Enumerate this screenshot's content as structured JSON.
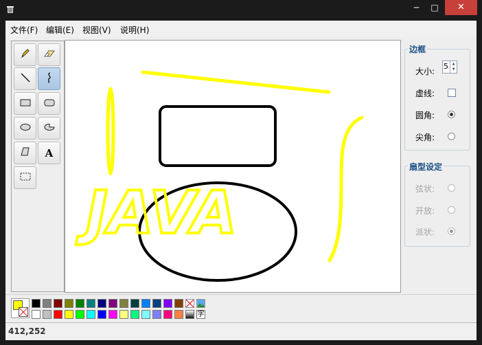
{
  "window": {
    "minimize": "─",
    "maximize": "□",
    "close": "✕"
  },
  "menu": [
    {
      "label": "文件(F)"
    },
    {
      "label": "编辑(E)"
    },
    {
      "label": "视图(V)"
    },
    {
      "label": "说明(H)"
    }
  ],
  "tools": [
    {
      "name": "pencil-icon",
      "selected": false
    },
    {
      "name": "eraser-icon",
      "selected": false
    },
    {
      "name": "line-icon",
      "selected": false
    },
    {
      "name": "curve-icon",
      "selected": true
    },
    {
      "name": "rectangle-icon",
      "selected": false
    },
    {
      "name": "rounded-rectangle-icon",
      "selected": false
    },
    {
      "name": "ellipse-icon",
      "selected": false
    },
    {
      "name": "pie-icon",
      "selected": false
    },
    {
      "name": "polygon-icon",
      "selected": false
    },
    {
      "name": "text-tool-icon",
      "selected": false
    },
    {
      "name": "select-icon",
      "selected": false
    }
  ],
  "text_tool_glyph": "A",
  "canvas": {
    "text": "JAVA",
    "stroke_color": "#000000",
    "fill_color": "#ffff00"
  },
  "border_panel": {
    "title": "边框",
    "size_label": "大小:",
    "size_value": "5",
    "dashed_label": "虚线:",
    "dashed_checked": false,
    "round_label": "圆角:",
    "round_selected": true,
    "sharp_label": "尖角:",
    "sharp_selected": false
  },
  "fan_panel": {
    "title": "扇型设定",
    "chord_label": "弦状:",
    "chord_selected": false,
    "open_label": "开放:",
    "open_selected": false,
    "pie_label": "派状:",
    "pie_selected": true
  },
  "palette": {
    "foreground": "#ffff00",
    "background": "none",
    "row1": [
      "#000000",
      "#808080",
      "#800000",
      "#808000",
      "#008000",
      "#008080",
      "#000080",
      "#800080",
      "#808040",
      "#004040",
      "#0080ff",
      "#004080",
      "#8000ff",
      "#804000"
    ],
    "row2": [
      "#ffffff",
      "#c0c0c0",
      "#ff0000",
      "#ffff00",
      "#00ff00",
      "#00ffff",
      "#0000ff",
      "#ff00ff",
      "#ffff80",
      "#00ff80",
      "#80ffff",
      "#8080ff",
      "#ff0080",
      "#ff8040"
    ],
    "text_swatch_glyph": "字"
  },
  "status": {
    "coords": "412,252"
  }
}
